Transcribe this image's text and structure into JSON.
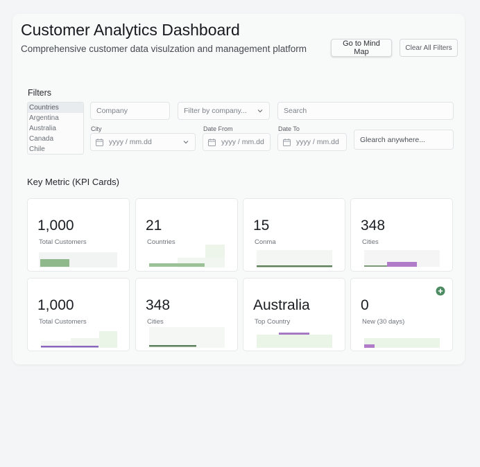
{
  "header": {
    "title": "Customer Analytics Dashboard",
    "subtitle": "Comprehensive customer data visulzation and management platform",
    "mindmap_button": "Go to Mind Map",
    "clear_button": "Clear All Filters"
  },
  "filters": {
    "title": "Filters",
    "countries": [
      "Countries",
      "Argentina",
      "Australia",
      "Canada",
      "Chile"
    ],
    "company_placeholder": "Company",
    "company_filter_placeholder": "Filter by company...",
    "search_placeholder": "Search",
    "city_label": "City",
    "city_placeholder": "yyyy / mm.dd",
    "date_from_label": "Date From",
    "date_from_placeholder": "yyyy / mm.dd",
    "date_to_label": "Date To",
    "date_to_placeholder": "yyyy / mm.dd",
    "search_anywhere_placeholder": "Glearch anywhere..."
  },
  "kpi": {
    "title": "Key Metric (KPI Cards)",
    "cards": [
      {
        "value": "1,000",
        "label": "Total Customers",
        "bar_color": "#8fb98a"
      },
      {
        "value": "21",
        "label": "Countries",
        "bar_color": "#9bc296"
      },
      {
        "value": "15",
        "label": "Conma",
        "bar_color": "#5d7f5a"
      },
      {
        "value": "348",
        "label": "Cities",
        "bar_color": "#b07cc8"
      },
      {
        "value": "1,000",
        "label": "Total Customers",
        "bar_color": "#8a66bf"
      },
      {
        "value": "348",
        "label": "Cities",
        "bar_color": "#5d7f5a"
      },
      {
        "value": "Australia",
        "label": "Top Country",
        "bar_color": "#a478c2"
      },
      {
        "value": "0",
        "label": "New (30 days)",
        "bar_color": "#b07cc8"
      }
    ]
  },
  "colors": {
    "accent_green": "#4c8a62",
    "bar_light": "#edf5ea"
  }
}
